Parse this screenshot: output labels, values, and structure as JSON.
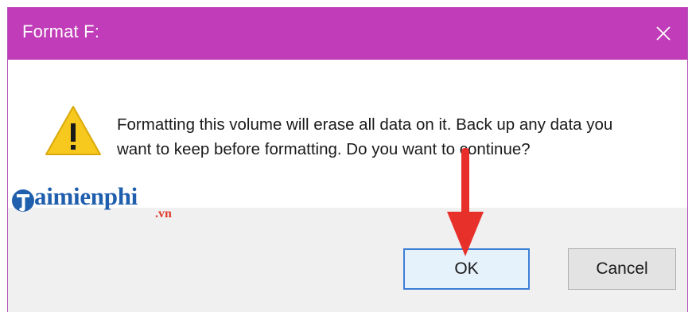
{
  "dialog": {
    "title": "Format F:",
    "close_icon": "close-icon",
    "message_line1": "Formatting this volume will erase all data on it. Back up any data you",
    "message_line2": "want to keep before formatting. Do you want to continue?",
    "warning_icon": "warning-icon",
    "buttons": {
      "ok": "OK",
      "cancel": "Cancel"
    }
  },
  "watermark": {
    "brand": "aimienphi",
    "suffix": ".vn"
  },
  "annotation": {
    "icon": "red-arrow-down-icon"
  },
  "colors": {
    "titlebar": "#c03cb8",
    "footer": "#f0f0f0",
    "ok_border": "#3c7fd6",
    "arrow": "#e8302a",
    "warning": "#f7c81e"
  }
}
